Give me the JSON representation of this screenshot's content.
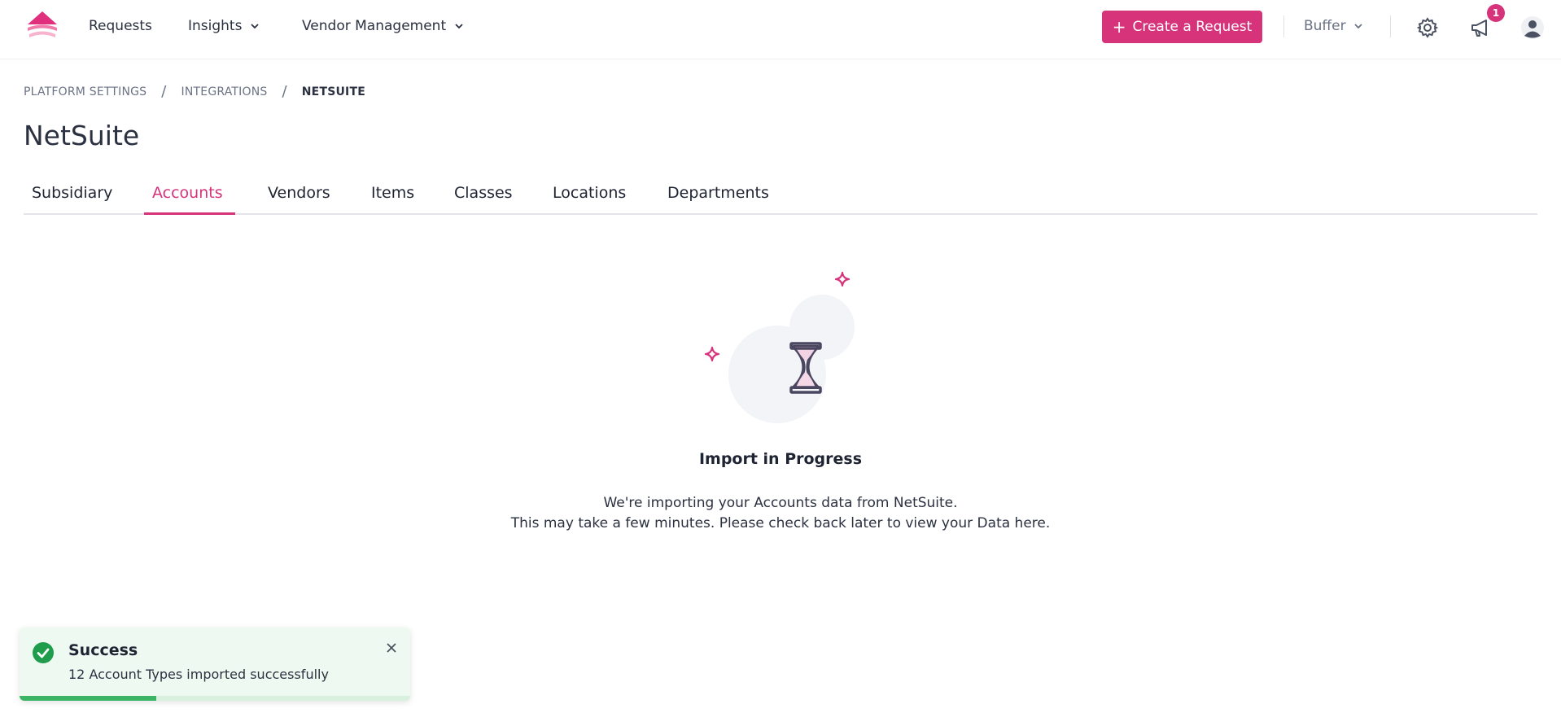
{
  "nav": {
    "items": [
      {
        "label": "Requests"
      },
      {
        "label": "Insights"
      },
      {
        "label": "Vendor Management"
      }
    ],
    "create_button": "Create a Request",
    "org_switcher": "Buffer",
    "notification_count": "1",
    "icons": [
      "logo-icon",
      "chevron-down-icon",
      "plus-icon",
      "gear-icon",
      "megaphone-icon",
      "user-icon"
    ]
  },
  "breadcrumb": {
    "items": [
      "PLATFORM SETTINGS",
      "INTEGRATIONS",
      "NETSUITE"
    ],
    "separator": "/"
  },
  "page": {
    "title": "NetSuite"
  },
  "tabs": [
    {
      "label": "Subsidiary"
    },
    {
      "label": "Accounts"
    },
    {
      "label": "Vendors"
    },
    {
      "label": "Items"
    },
    {
      "label": "Classes"
    },
    {
      "label": "Locations"
    },
    {
      "label": "Departments"
    }
  ],
  "active_tab": "Accounts",
  "empty_state": {
    "icon": "hourglass-icon",
    "title": "Import in Progress",
    "line1": "We're importing your Accounts data from NetSuite.",
    "line2": "This may take a few minutes. Please check back later to view your Data here."
  },
  "toast": {
    "title": "Success",
    "message": "12 Account Types imported successfully",
    "progress": 0.35
  },
  "colors": {
    "accent": "#d6337b",
    "success": "#3bb565",
    "toast_bg": "#eefaf1"
  }
}
